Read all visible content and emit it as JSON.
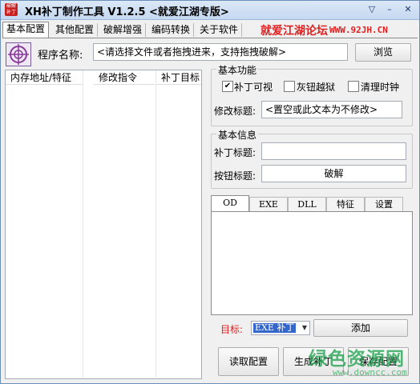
{
  "window": {
    "app_icon_text": "破解补丁",
    "title": "XH补丁制作工具 V1.2.5 <就爱江湖专版>",
    "pin_glyph": "▽",
    "minimize_glyph": "–",
    "close_glyph": "✕"
  },
  "tabs": [
    {
      "label": "基本配置",
      "active": true
    },
    {
      "label": "其他配置"
    },
    {
      "label": "破解增强"
    },
    {
      "label": "编码转换"
    },
    {
      "label": "关于软件"
    }
  ],
  "banner": {
    "slogan": "就爱江湖论坛",
    "url": "WWW.92JH.CN"
  },
  "program": {
    "label": "程序名称:",
    "value": "<请选择文件或者拖拽进来，支持拖拽破解>",
    "browse_label": "浏览"
  },
  "list": {
    "columns": [
      "内存地址/特征",
      "修改指令",
      "补丁目标"
    ]
  },
  "basic_functions": {
    "title": "基本功能",
    "checkboxes": [
      {
        "label": "补丁可视",
        "checked": true
      },
      {
        "label": "灰钮越狱",
        "checked": false
      },
      {
        "label": "清理时钟",
        "checked": false
      }
    ],
    "modify_title_label": "修改标题:",
    "modify_title_value": "<置空或此文本为不修改>"
  },
  "basic_info": {
    "title": "基本信息",
    "patch_title_label": "补丁标题:",
    "patch_title_value": "",
    "button_title_label": "按钮标题:",
    "button_title_value": "破解"
  },
  "sub_tabs": [
    {
      "label": "OD",
      "active": true
    },
    {
      "label": "EXE"
    },
    {
      "label": "DLL"
    },
    {
      "label": "特征"
    },
    {
      "label": "设置"
    }
  ],
  "target": {
    "label": "目标:",
    "selected": "EXE 补丁",
    "add_label": "添加",
    "label_color": "#e02020"
  },
  "actions": {
    "read": "读取配置",
    "generate": "生成补丁",
    "save": "保存配置"
  },
  "watermark": {
    "main": "绿色资源网",
    "sub": "www.downcc.com"
  }
}
